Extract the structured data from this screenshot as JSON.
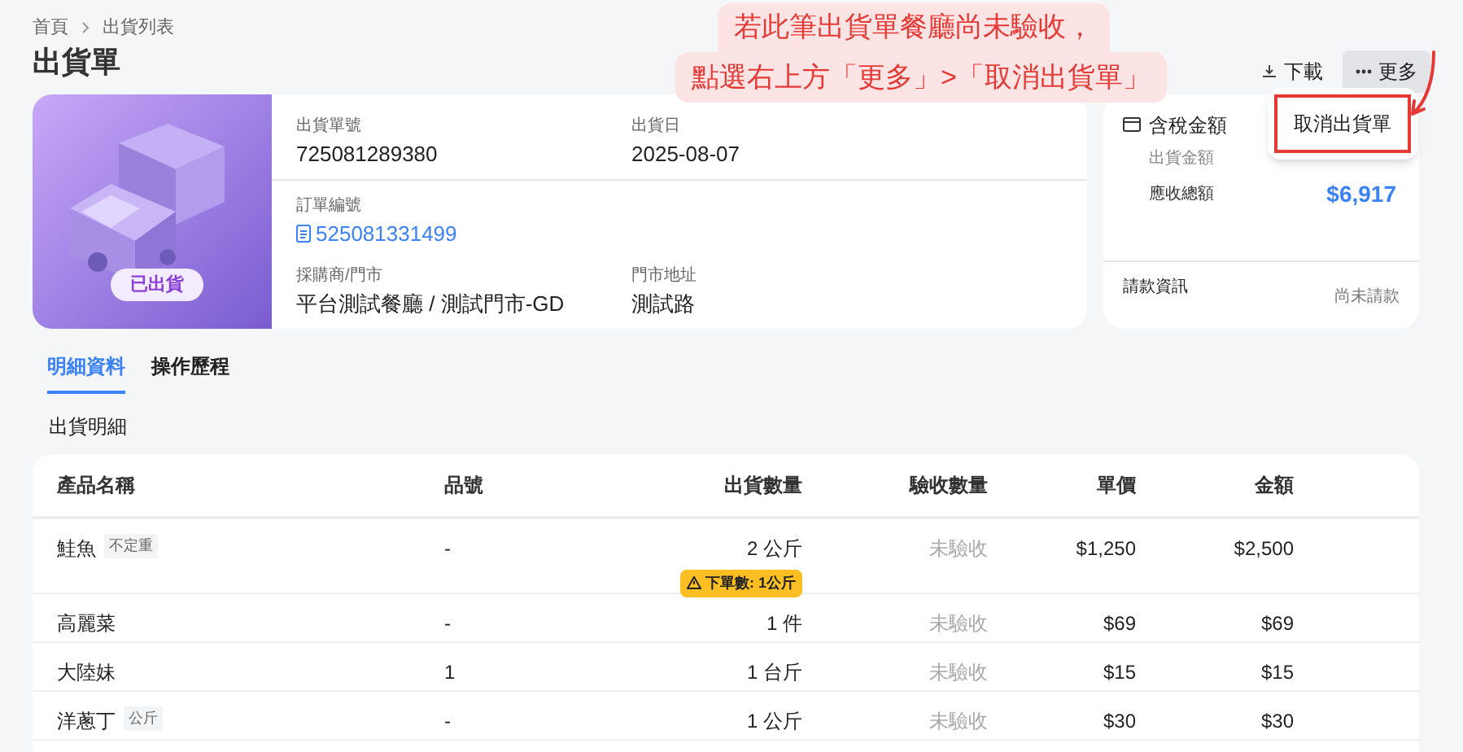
{
  "breadcrumb": [
    "首頁",
    "出貨列表"
  ],
  "title": "出貨單",
  "actions": {
    "download": "下載",
    "more": "更多",
    "more_expanded": true,
    "menu_items": [
      {
        "label": "取消出貨單",
        "highlighted": true
      }
    ]
  },
  "annotation": {
    "lines": [
      "若此筆出貨單餐廳尚未驗收，",
      "點選右上方「更多」>「取消出貨單」"
    ]
  },
  "shipment": {
    "status": "已出貨",
    "fields": [
      {
        "label": "出貨單號",
        "value": "725081289380"
      },
      {
        "label": "出貨日",
        "value": "2025-08-07"
      }
    ],
    "order": {
      "label": "訂單編號",
      "value": "525081331499"
    },
    "fields_bottom": [
      {
        "label": "採購商/門市",
        "value": "平台測試餐廳 / 測試門市-GD"
      },
      {
        "label": "門市地址",
        "value": "測試路"
      }
    ]
  },
  "amount": {
    "title": "含稅金額",
    "rows": [
      {
        "label": "出貨金額",
        "value": "",
        "kind": "plain"
      },
      {
        "label": "應收總額",
        "value": "$6,917",
        "kind": "total"
      }
    ],
    "billing_label": "請款資訊",
    "billing_status": "尚未請款"
  },
  "tabs": [
    {
      "label": "明細資料",
      "selected": true
    },
    {
      "label": "操作歷程",
      "selected": false
    }
  ],
  "section_title": "出貨明細",
  "table": {
    "columns": [
      "產品名稱",
      "品號",
      "出貨數量",
      "驗收數量",
      "單價",
      "金額"
    ],
    "rows": [
      {
        "name": "鮭魚",
        "tag": "不定重",
        "code": "-",
        "qty": "2 公斤",
        "warning": "下單數: 1公斤",
        "received": "未驗收",
        "price": "$1,250",
        "amount": "$2,500"
      },
      {
        "name": "高麗菜",
        "code": "-",
        "qty": "1 件",
        "received": "未驗收",
        "price": "$69",
        "amount": "$69"
      },
      {
        "name": "大陸妹",
        "code": "1",
        "qty": "1 台斤",
        "received": "未驗收",
        "price": "$15",
        "amount": "$15"
      },
      {
        "name": "洋蔥丁",
        "tag": "公斤",
        "code": "-",
        "qty": "1 公斤",
        "received": "未驗收",
        "price": "$30",
        "amount": "$30"
      }
    ]
  }
}
